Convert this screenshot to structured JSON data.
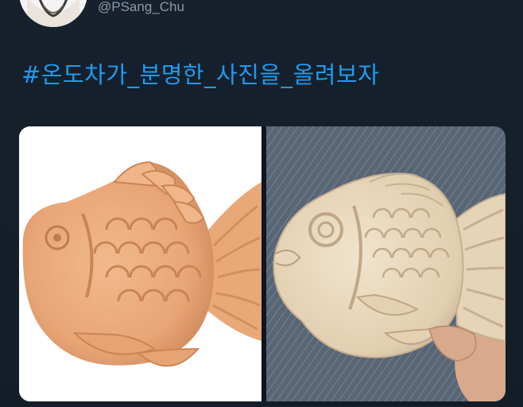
{
  "tweet": {
    "handle": "@PSang_Chu",
    "text": "#온도차가_분명한_사진을_올려보자"
  },
  "icons": {
    "avatar": "profile-avatar"
  },
  "colors": {
    "background": "#15202b",
    "hashtag": "#1d9bf0",
    "handle": "#8a98a7"
  }
}
